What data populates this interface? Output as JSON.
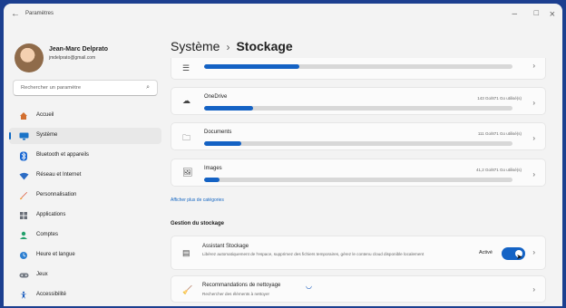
{
  "titlebar": {
    "back_icon": "back-arrow-icon",
    "title": "Paramètres",
    "minimize": "–",
    "maximize": "□",
    "close": "×"
  },
  "profile": {
    "name": "Jean-Marc Delprato",
    "email": "jmdelprato@gmail.com"
  },
  "search": {
    "placeholder": "Rechercher un paramètre",
    "icon": "search-icon"
  },
  "sidebar": {
    "items": [
      {
        "label": "Accueil",
        "icon": "home-icon",
        "active": false
      },
      {
        "label": "Système",
        "icon": "system-icon",
        "active": true
      },
      {
        "label": "Bluetooth et appareils",
        "icon": "bluetooth-icon",
        "active": false
      },
      {
        "label": "Réseau et Internet",
        "icon": "network-icon",
        "active": false
      },
      {
        "label": "Personnalisation",
        "icon": "brush-icon",
        "active": false
      },
      {
        "label": "Applications",
        "icon": "apps-icon",
        "active": false
      },
      {
        "label": "Comptes",
        "icon": "account-icon",
        "active": false
      },
      {
        "label": "Heure et langue",
        "icon": "time-language-icon",
        "active": false
      },
      {
        "label": "Jeux",
        "icon": "games-icon",
        "active": false
      },
      {
        "label": "Accessibilité",
        "icon": "accessibility-icon",
        "active": false
      }
    ]
  },
  "breadcrumb": {
    "parent": "Système",
    "separator": "›",
    "current": "Stockage"
  },
  "storage_rows": [
    {
      "label": "",
      "value": "",
      "icon": "list-icon",
      "progress": 0.31
    },
    {
      "label": "OneDrive",
      "value": "143 Go/871 Go utilisé(s)",
      "icon": "cloud-icon",
      "progress": 0.16
    },
    {
      "label": "Documents",
      "value": "111 Go/871 Go utilisé(s)",
      "icon": "folder-icon",
      "progress": 0.12
    },
    {
      "label": "Images",
      "value": "41,2 Go/871 Go utilisé(s)",
      "icon": "image-icon",
      "progress": 0.05
    }
  ],
  "more_categories": "Afficher plus de catégories",
  "section": {
    "title": "Gestion du stockage"
  },
  "assistant": {
    "title": "Assistant Stockage",
    "description": "Libérez automatiquement de l'espace, supprimez des fichiers temporaires, gérez le contenu cloud disponible localement",
    "status": "Activé",
    "enabled": true,
    "icon": "storage-assistant-icon"
  },
  "cleanup": {
    "title": "Recommandations de nettoyage",
    "description": "Rechercher des éléments à nettoyer",
    "icon": "cleanup-icon",
    "spinner_icon": "loading-icon"
  },
  "chevron_icon": "chevron-right-icon"
}
